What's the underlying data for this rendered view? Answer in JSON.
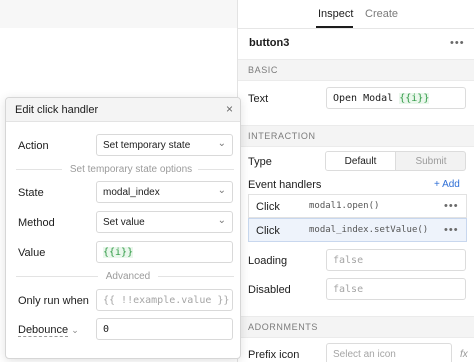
{
  "inspector": {
    "tabs": [
      {
        "label": "Inspect"
      },
      {
        "label": "Create"
      }
    ],
    "component_name": "button3",
    "more_label": "•••",
    "sections": {
      "basic": "BASIC",
      "interaction": "INTERACTION",
      "adornments": "ADORNMENTS"
    },
    "text_field": {
      "label": "Text",
      "value_plain": "Open Modal ",
      "value_binding": "{{i}}"
    },
    "type_field": {
      "label": "Type",
      "options": [
        "Default",
        "Submit"
      ],
      "selected": "Default"
    },
    "event_handlers": {
      "label": "Event handlers",
      "add_label": "+ Add",
      "rows": [
        {
          "event": "Click",
          "action": "modal1.open()"
        },
        {
          "event": "Click",
          "action": "modal_index.setValue()"
        }
      ]
    },
    "loading_field": {
      "label": "Loading",
      "placeholder": "false"
    },
    "disabled_field": {
      "label": "Disabled",
      "placeholder": "false"
    },
    "prefix_icon_field": {
      "label": "Prefix icon",
      "placeholder": "Select an icon",
      "fx": "fx"
    }
  },
  "modal": {
    "title": "Edit click handler",
    "close_icon": "×",
    "action": {
      "label": "Action",
      "value": "Set temporary state"
    },
    "options_divider": "Set temporary state options",
    "state": {
      "label": "State",
      "value": "modal_index"
    },
    "method": {
      "label": "Method",
      "value": "Set value"
    },
    "value_field": {
      "label": "Value",
      "value": "{{i}}"
    },
    "advanced_divider": "Advanced",
    "only_run_when": {
      "label": "Only run when",
      "placeholder": "{{ !!example.value }}"
    },
    "debounce": {
      "label": "Debounce",
      "value": "0"
    }
  },
  "colors": {
    "accent": "#2f6fd6",
    "binding_green": "#2f9a45",
    "selected_row": "#eef3fb"
  },
  "icons": {
    "close": "close-icon",
    "chevron": "chevron-down-icon",
    "more": "more-dots-icon",
    "fx": "fx-icon"
  }
}
